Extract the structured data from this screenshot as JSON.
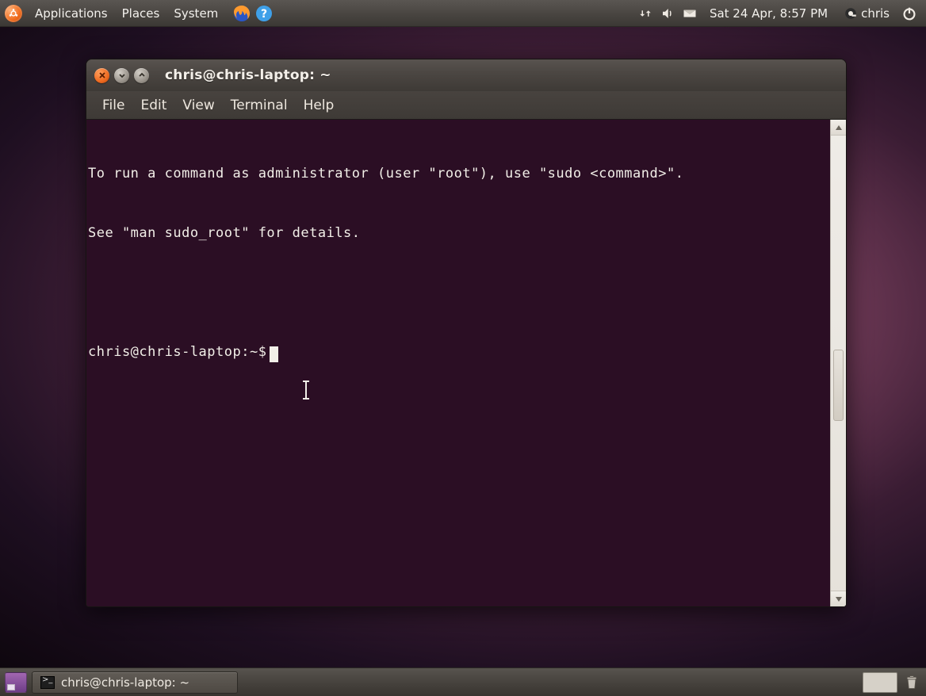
{
  "top_panel": {
    "menus": [
      "Applications",
      "Places",
      "System"
    ],
    "datetime": "Sat 24 Apr,  8:57 PM",
    "username": "chris"
  },
  "window": {
    "title": "chris@chris-laptop: ~",
    "menubar": [
      "File",
      "Edit",
      "View",
      "Terminal",
      "Help"
    ]
  },
  "terminal": {
    "line1": "To run a command as administrator (user \"root\"), use \"sudo <command>\".",
    "line2": "See \"man sudo_root\" for details.",
    "prompt": "chris@chris-laptop:~$"
  },
  "taskbar": {
    "task_title": "chris@chris-laptop: ~"
  }
}
